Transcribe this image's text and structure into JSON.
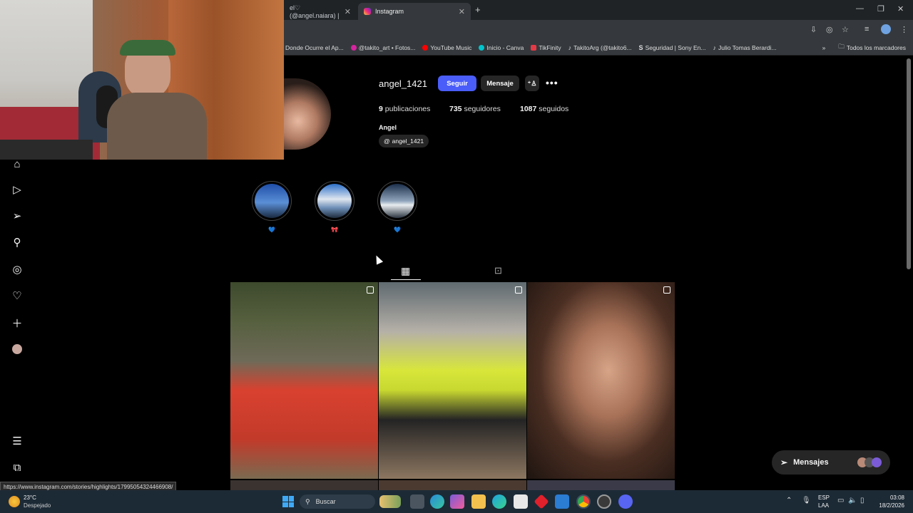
{
  "browser": {
    "tabs": [
      {
        "label": "el♡ (@angel.naiara) |"
      },
      {
        "label": "Instagram"
      }
    ],
    "new_tab": "+",
    "bookmarks": [
      {
        "label": "Donde Ocurre el Ap...",
        "color": "#2d2d2d"
      },
      {
        "label": "@takito_art • Fotos...",
        "color": "#d6249f"
      },
      {
        "label": "YouTube Music",
        "color": "#ff0000"
      },
      {
        "label": "Inicio - Canva",
        "color": "#00c4cc"
      },
      {
        "label": "TikFinity",
        "color": "#e63946"
      },
      {
        "label": "TakitoArg (@takito6...",
        "color": "#111111"
      },
      {
        "label": "Seguridad | Sony En...",
        "color": "#ffffff"
      },
      {
        "label": "Julio Tomas Berardi...",
        "color": "#111111"
      }
    ],
    "more": "»",
    "all_bookmarks": "Todos los marcadores",
    "status_url": "https://www.instagram.com/stories/highlights/17995054324466908/"
  },
  "profile": {
    "username": "angel_1421",
    "follow_label": "Seguir",
    "message_label": "Mensaje",
    "posts_count": "9",
    "posts_label": "publicaciones",
    "followers_count": "735",
    "followers_label": "seguidores",
    "following_count": "1087",
    "following_label": "seguidos",
    "name": "Angel",
    "threads_handle": "angel_1421"
  },
  "highlights": [
    {
      "label": "💙"
    },
    {
      "label": "🎀"
    },
    {
      "label": "💙"
    }
  ],
  "messages_label": "Mensajes",
  "taskbar": {
    "weather_temp": "23°C",
    "weather_desc": "Despejado",
    "search_placeholder": "Buscar",
    "lang_top": "ESP",
    "lang_bottom": "LAA",
    "time": "03:08",
    "date": "18/2/2026"
  },
  "colors": {
    "accent": "#4a5df9",
    "background": "#000000"
  }
}
